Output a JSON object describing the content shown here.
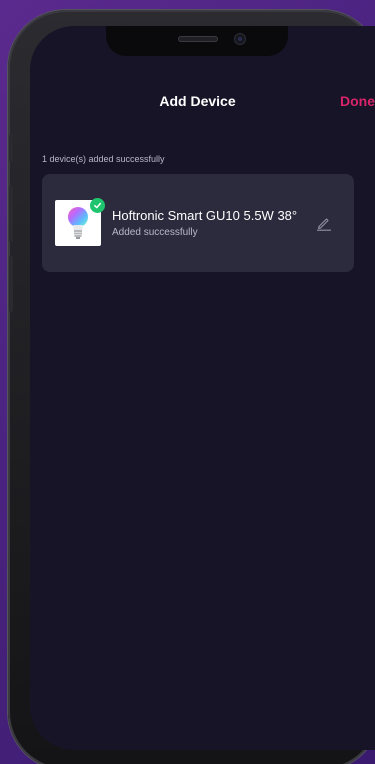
{
  "header": {
    "title": "Add Device",
    "done_label": "Done"
  },
  "status": {
    "summary": "1 device(s) added successfully"
  },
  "devices": [
    {
      "name": "Hoftronic Smart GU10 5.5W 38°",
      "status": "Added successfully",
      "icon": "smart-bulb-icon"
    }
  ],
  "colors": {
    "accent": "#d8246a",
    "success": "#1fc46e",
    "background": "#161426",
    "card": "#2c2a3d"
  }
}
